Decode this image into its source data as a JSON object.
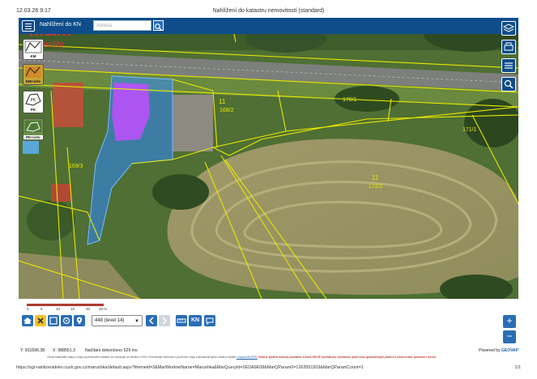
{
  "print_header": {
    "timestamp": "12.03.26 9:17",
    "title": "Nahlížení do katastru nemovitostí (standard)"
  },
  "app": {
    "title": "Nahlížení do KN",
    "search_placeholder": "Adresa",
    "accent": "#0f4d8a",
    "button_blue": "#2a6db5"
  },
  "logo": {
    "text": "M&M",
    "sub": "Reality",
    "color": "#e0303a"
  },
  "map": {
    "parcel_labels": [
      "170/1",
      "171/1",
      "172/2",
      "169/3",
      "168/2",
      "11",
      "11"
    ],
    "parcel_line_color": "#e8e800",
    "highlight_fill": "#2f88ff",
    "building_fill": "#c04dff"
  },
  "left_tools": [
    {
      "name": "km",
      "label": "KM"
    },
    {
      "name": "km-orto",
      "label": "KM+orto"
    },
    {
      "name": "pk",
      "label": "PK"
    },
    {
      "name": "pk-orto",
      "label": "PK+orto"
    }
  ],
  "right_tools": [
    "layers-icon",
    "print-icon",
    "list-icon",
    "search-icon"
  ],
  "scale": {
    "ticks": [
      "0",
      "5",
      "10",
      "15",
      "20",
      "25 m"
    ]
  },
  "bottom": {
    "level_label": "448 (level 14)",
    "kn_label": "KN",
    "zoom_in": "+",
    "zoom_out": "−"
  },
  "status": {
    "y": "Y: 811696.38",
    "x": "X: 988551.3",
    "loaded": "Načítání dokončeno 529 ms",
    "powered_prefix": "Powered by",
    "powered_brand": "GEOVAP"
  },
  "disclaimer": {
    "text": "Obsah katastrální mapy a mapy pozemkového katastru se zobrazuje od měřítka 1:0000. Podrobnější informace k používání mapy a aktuálnosti jejího obsahu najdete",
    "link": "v nápovědě (PDF)",
    "warning": "Veškeré zjištěné hodnoty souřadnic a délek NELZE využívat pro vyhotovení ploch nebo geometrických plánů a k určení hranic pozemků v terénu."
  },
  "print_footer": {
    "url": "https://sgi-nahlizenidokn.cuzk.gov.cz/marushka/default.aspx?themeid=3&MarWindowName=Marushka&MarQueryId=2EDA9E08&MarQParam0=1263551503&MarQParamCount=1",
    "page": "1/1"
  }
}
